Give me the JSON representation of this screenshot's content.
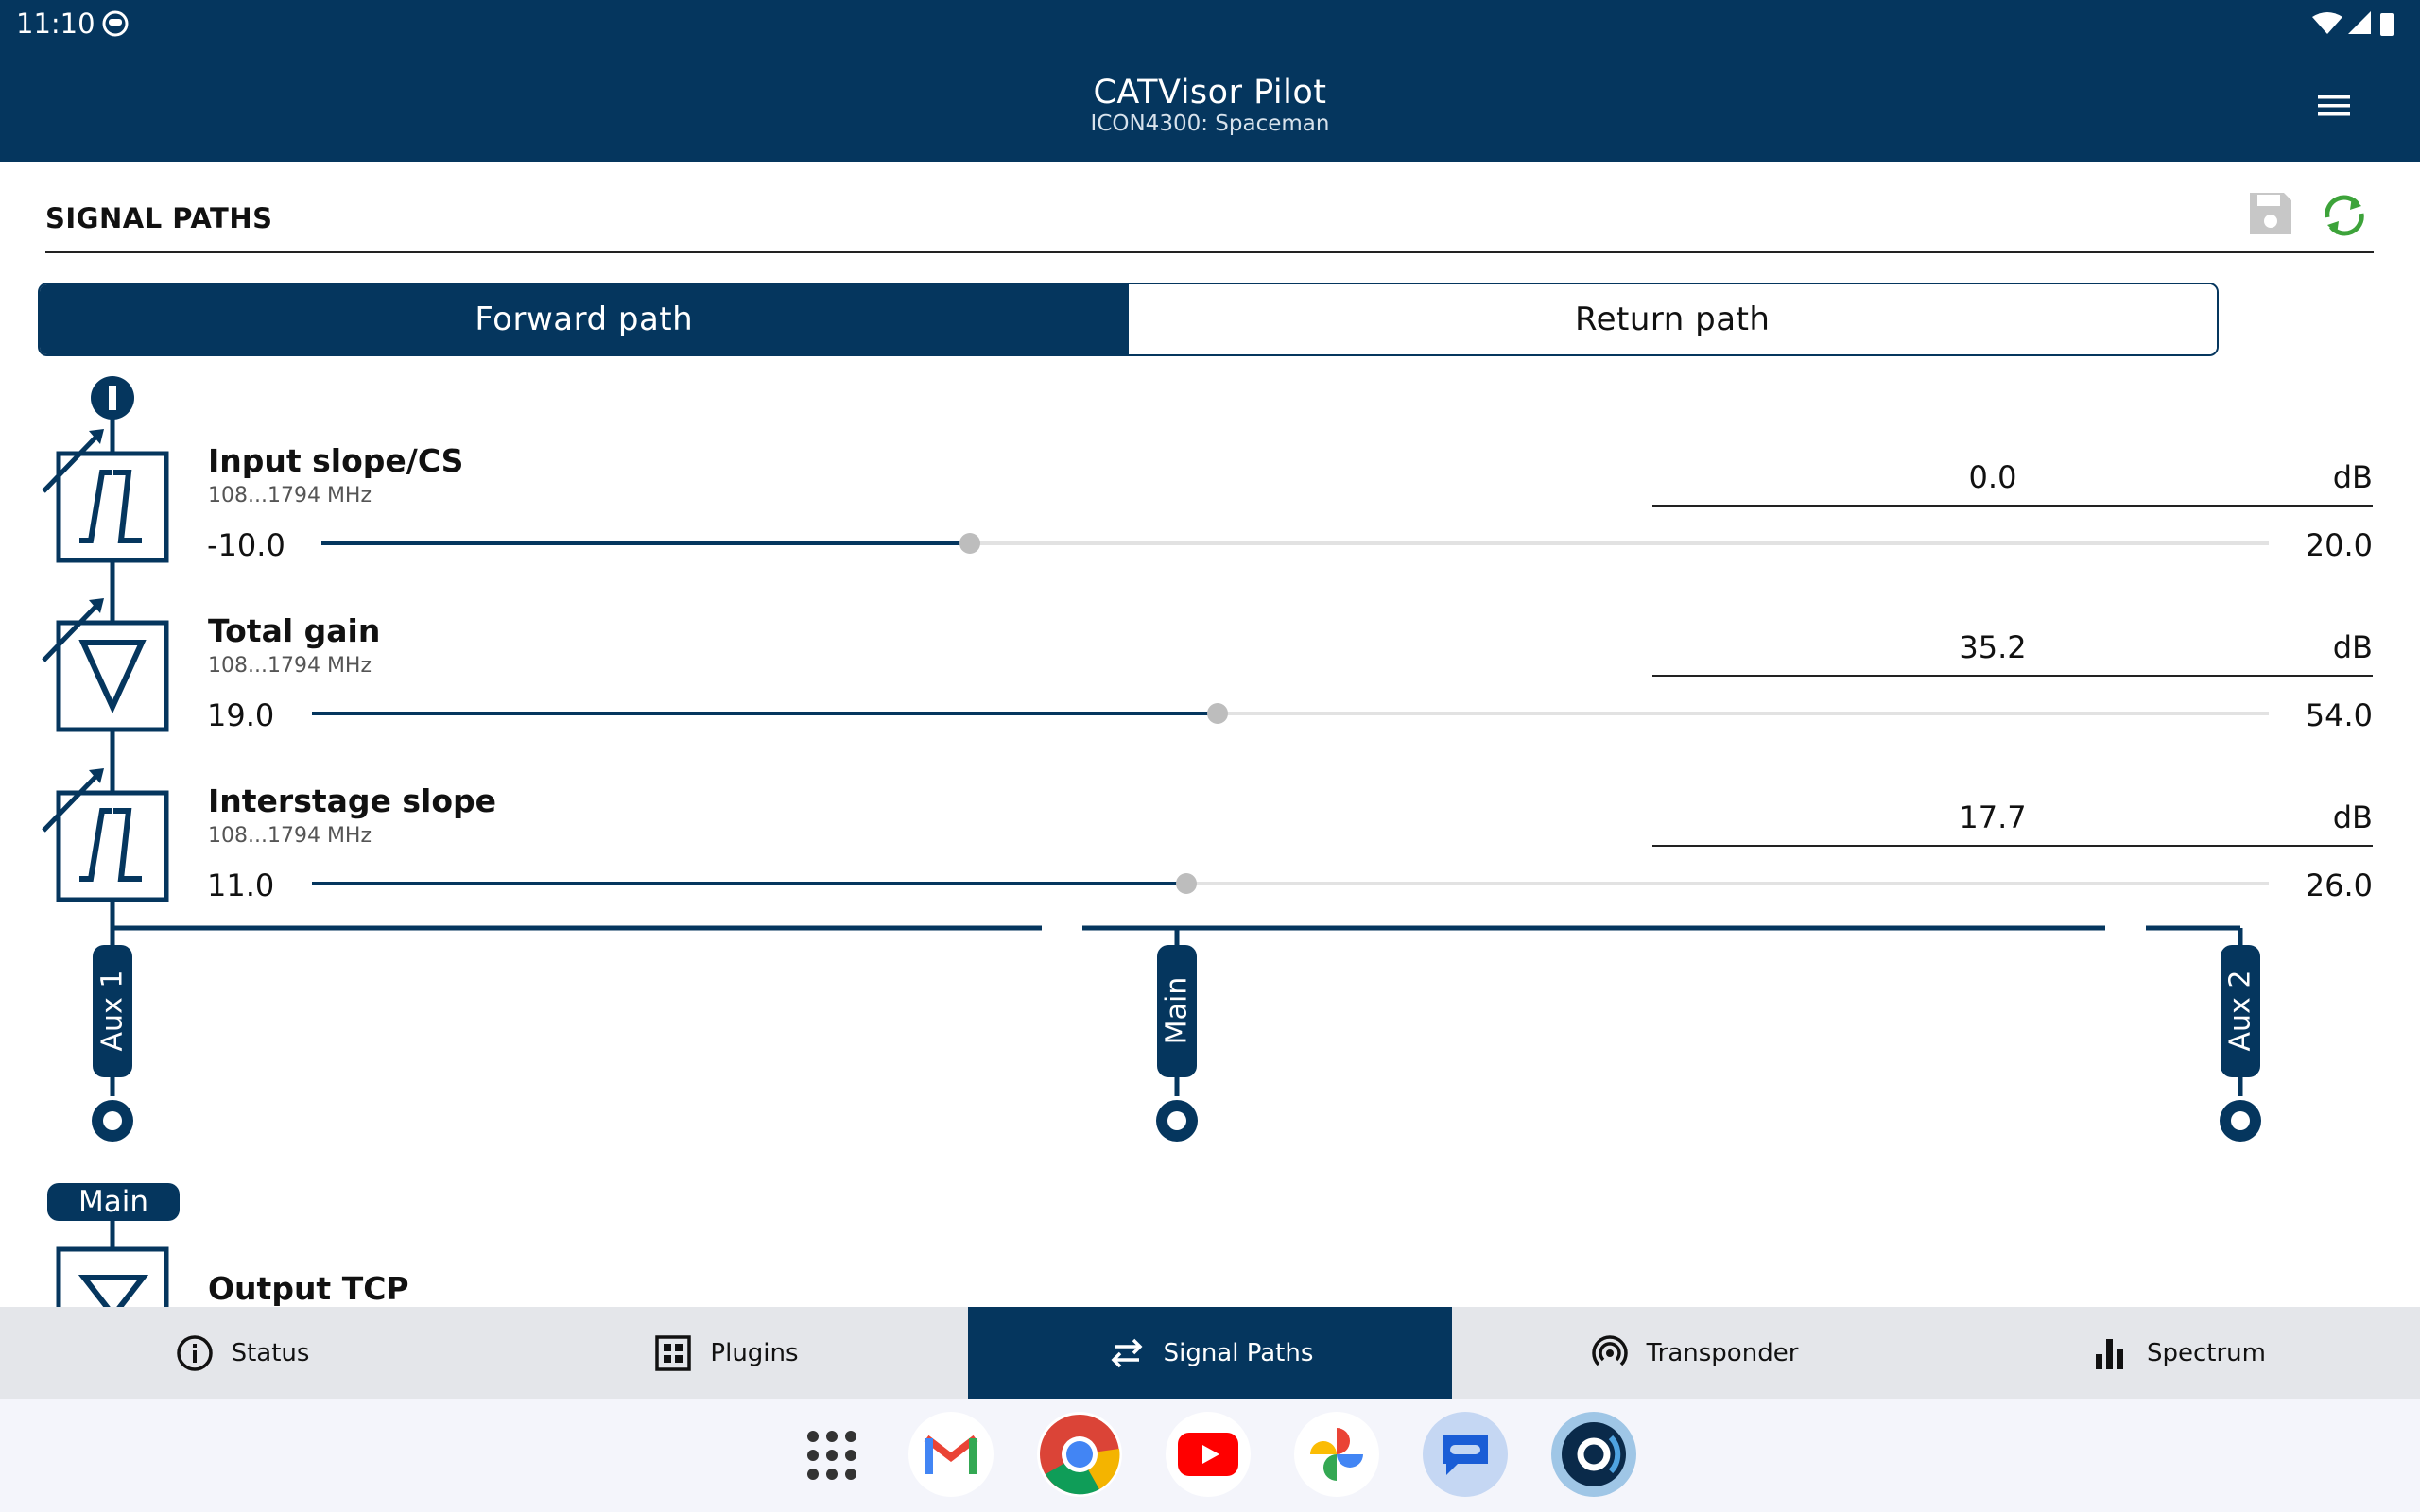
{
  "status_bar": {
    "time": "11:10"
  },
  "app_bar": {
    "title": "CATVisor Pilot",
    "subtitle": "ICON4300: Spaceman"
  },
  "section": {
    "title": "SIGNAL PATHS"
  },
  "tabs": [
    {
      "label": "Forward path",
      "active": true
    },
    {
      "label": "Return path",
      "active": false
    }
  ],
  "rows": [
    {
      "name": "Input slope/CS",
      "range": "108...1794 MHz",
      "value": "0.0",
      "unit": "dB",
      "min": "-10.0",
      "max": "20.0",
      "level": 0.333
    },
    {
      "name": "Total gain",
      "range": "108...1794 MHz",
      "value": "35.2",
      "unit": "dB",
      "min": "19.0",
      "max": "54.0",
      "level": 0.463
    },
    {
      "name": "Interstage slope",
      "range": "108...1794 MHz",
      "value": "17.7",
      "unit": "dB",
      "min": "11.0",
      "max": "26.0",
      "level": 0.447
    }
  ],
  "outputs": {
    "aux1": "Aux 1",
    "main": "Main",
    "aux2": "Aux 2"
  },
  "lower_section": {
    "badge": "Main",
    "next_row_name": "Output TCP"
  },
  "bottom_nav": [
    {
      "label": "Status",
      "icon": "info-icon",
      "active": false
    },
    {
      "label": "Plugins",
      "icon": "plugins-icon",
      "active": false
    },
    {
      "label": "Signal Paths",
      "icon": "swap-arrows-icon",
      "active": true
    },
    {
      "label": "Transponder",
      "icon": "broadcast-icon",
      "active": false
    },
    {
      "label": "Spectrum",
      "icon": "bar-chart-icon",
      "active": false
    }
  ],
  "colors": {
    "primary": "#05365e",
    "accent_green": "#3da33a",
    "track": "#e2e2e2",
    "thumb": "#bdbdbd"
  },
  "dock_apps": [
    "app-drawer-icon",
    "gmail-icon",
    "chrome-icon",
    "youtube-icon",
    "photos-icon",
    "messages-icon",
    "catvisor-icon"
  ]
}
